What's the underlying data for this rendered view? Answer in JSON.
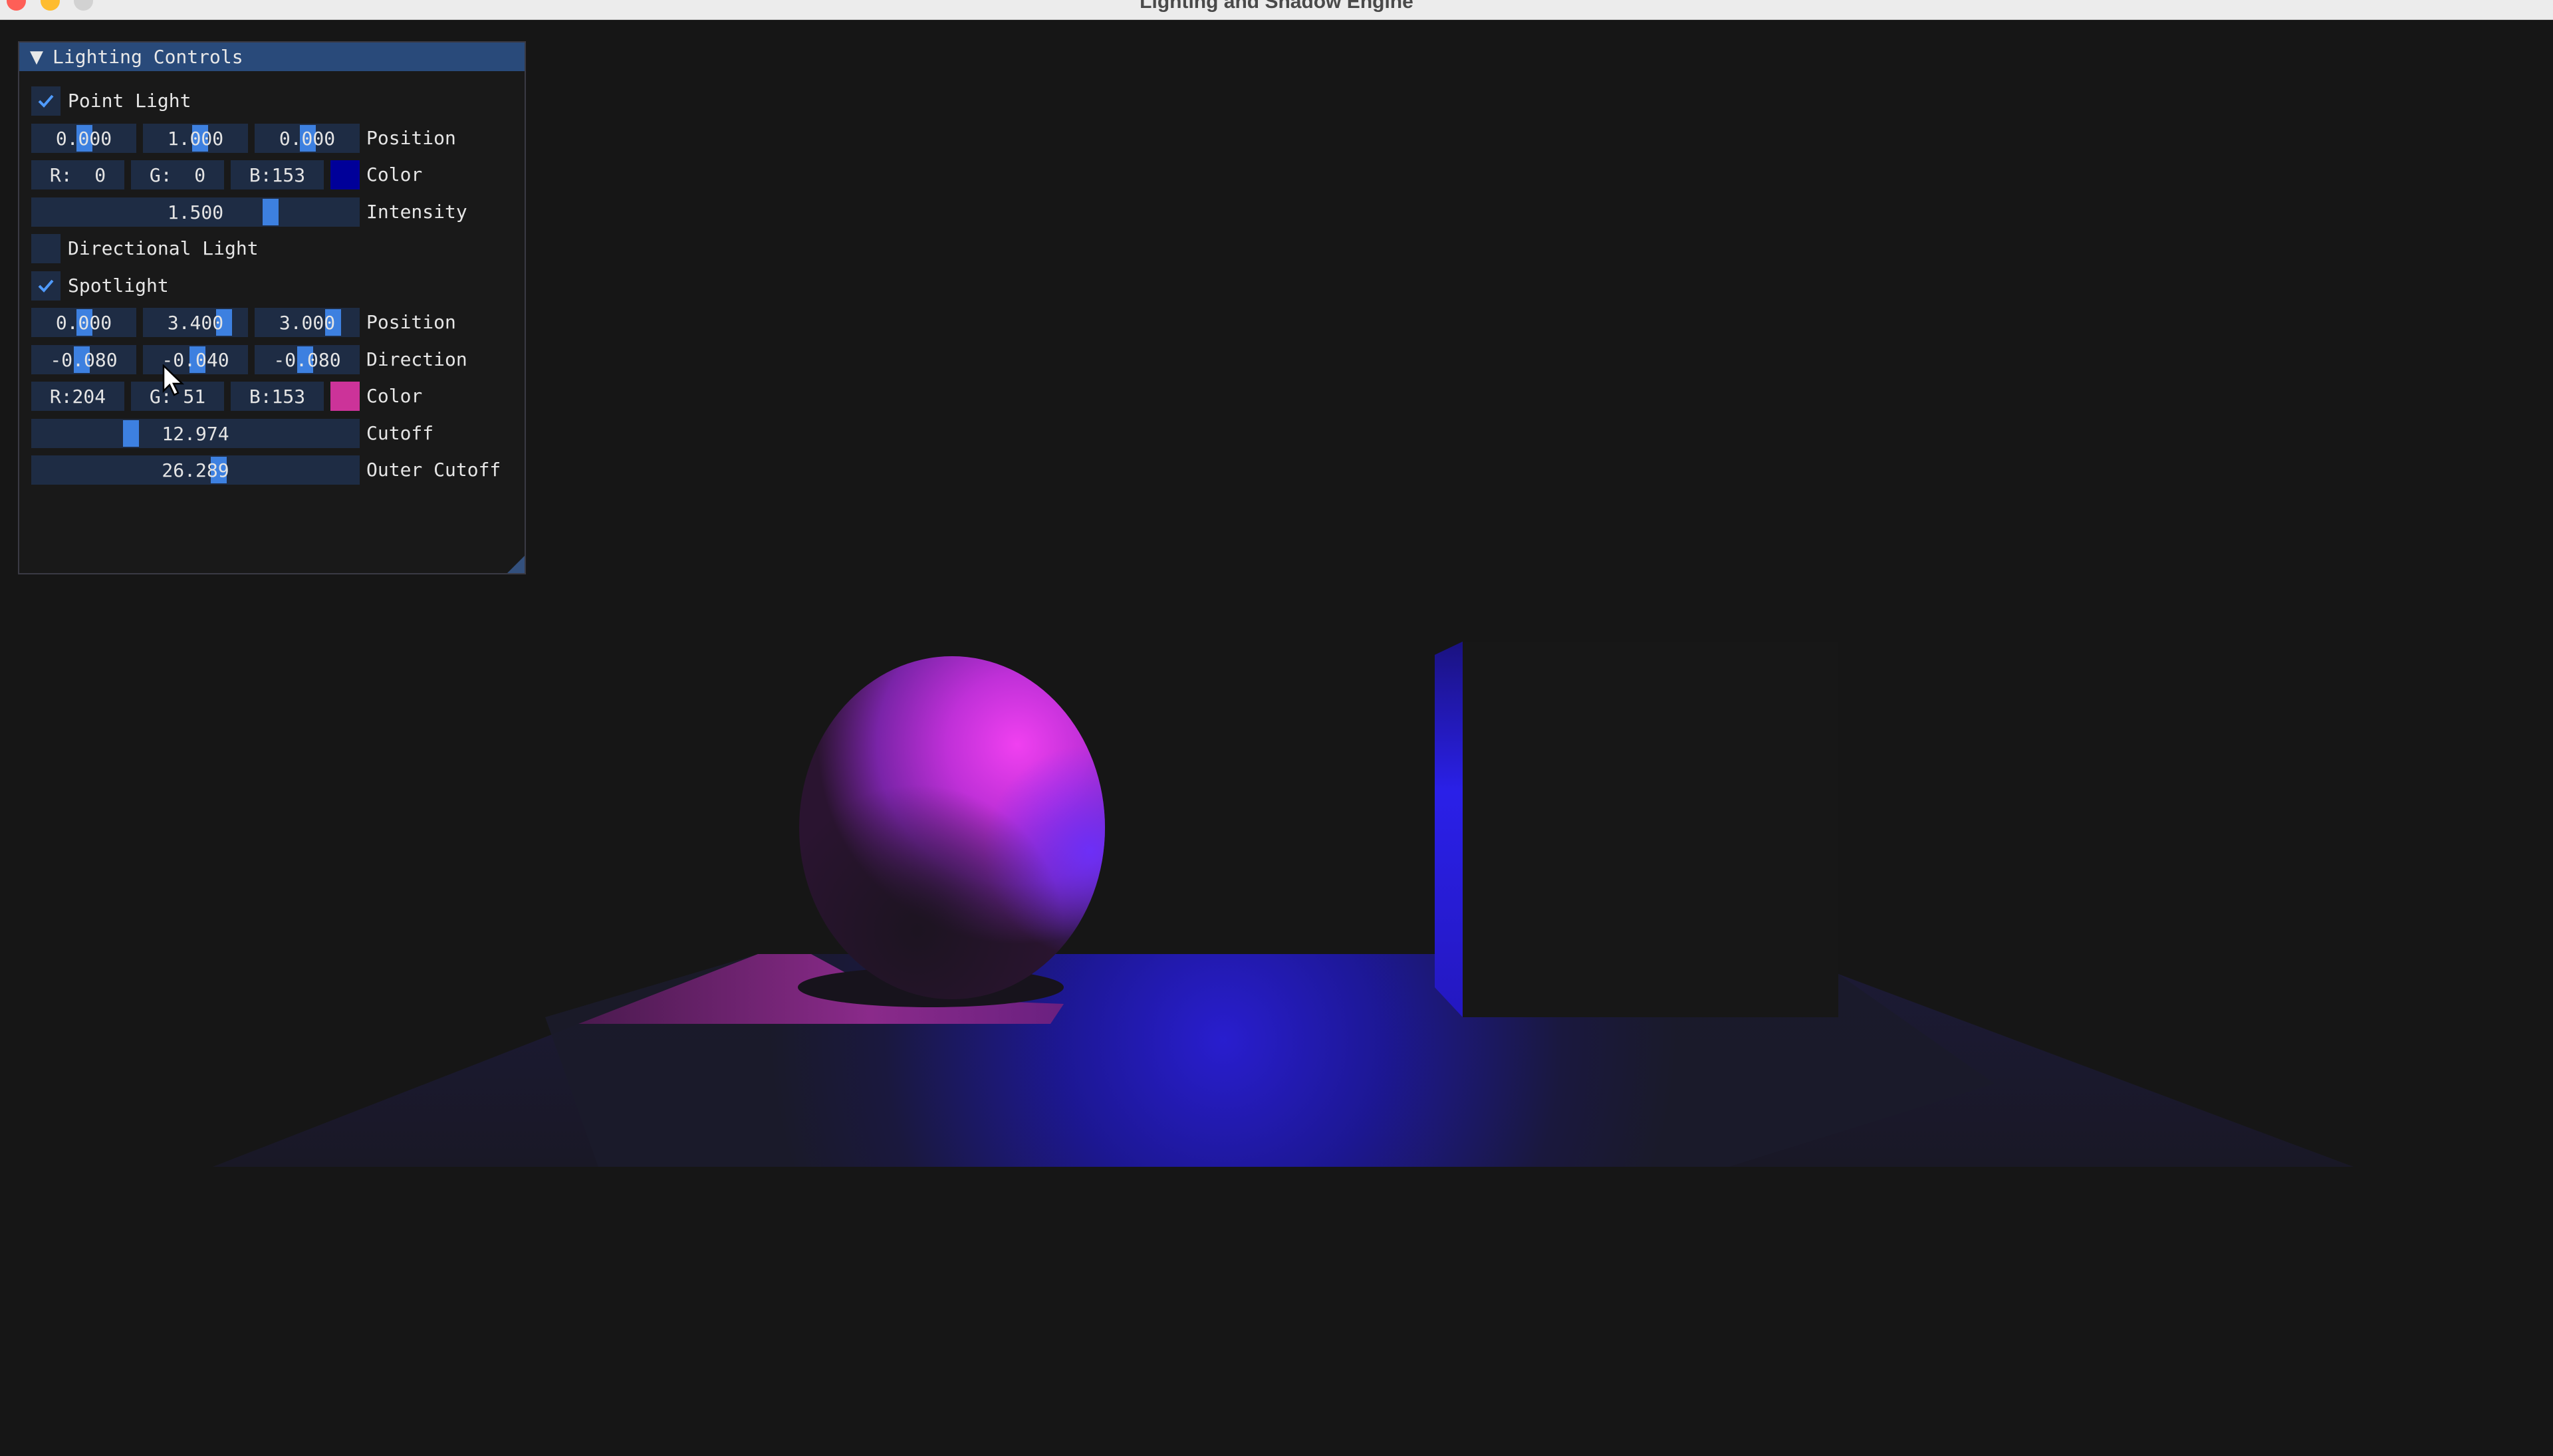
{
  "window": {
    "title": "Lighting and Shadow Engine"
  },
  "panel": {
    "title": "Lighting Controls",
    "point_light": {
      "label": "Point Light",
      "enabled": true,
      "position": [
        "0.000",
        "1.000",
        "0.000"
      ],
      "position_label": "Position",
      "color": {
        "r": "R:  0",
        "g": "G:  0",
        "b": "B:153",
        "label": "Color",
        "swatch": "#000099"
      },
      "intensity": {
        "value": "1.500",
        "label": "Intensity"
      }
    },
    "directional_light": {
      "label": "Directional Light",
      "enabled": false
    },
    "spotlight": {
      "label": "Spotlight",
      "enabled": true,
      "position": [
        "0.000",
        "3.400",
        "3.000"
      ],
      "position_label": "Position",
      "direction": [
        "-0.080",
        "-0.040",
        "-0.080"
      ],
      "direction_label": "Direction",
      "color": {
        "r": "R:204",
        "g": "G: 51",
        "b": "B:153",
        "label": "Color",
        "swatch": "#cc3399"
      },
      "cutoff": {
        "value": "12.974",
        "label": "Cutoff"
      },
      "outer_cutoff": {
        "value": "26.289",
        "label": "Outer Cutoff"
      }
    }
  },
  "colors": {
    "header": "#294a7a",
    "frame": "#1e2c44",
    "grab": "#3d80e0",
    "checkmark": "#4f9bff",
    "scene_background": "#161616"
  }
}
